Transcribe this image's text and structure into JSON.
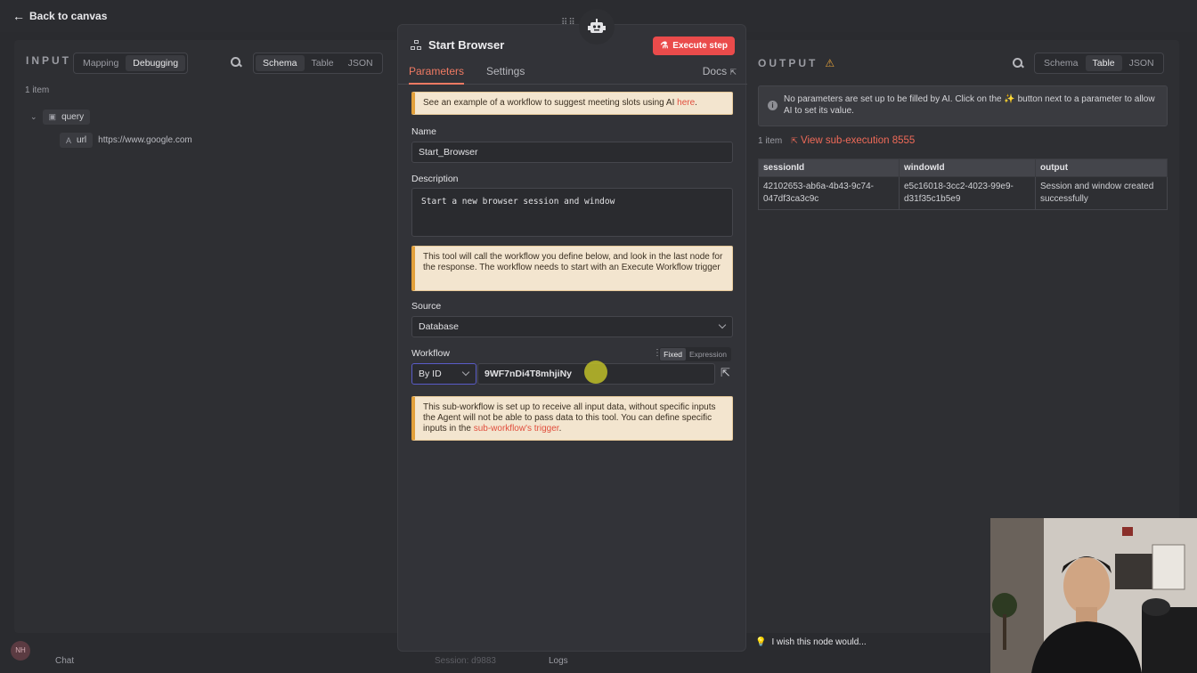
{
  "topbar": {
    "back_label": "Back to canvas"
  },
  "input_panel": {
    "title": "INPUT",
    "mode_tabs": [
      "Mapping",
      "Debugging"
    ],
    "view_tabs": [
      "Schema",
      "Table",
      "JSON"
    ],
    "item_count": "1 item",
    "tree": {
      "root_label": "query",
      "child_type": "A",
      "child_key": "url",
      "child_value": "https://www.google.com"
    }
  },
  "node": {
    "title": "Start Browser",
    "execute_label": "Execute step",
    "tabs": [
      "Parameters",
      "Settings"
    ],
    "docs_label": "Docs",
    "example_notice": "See an example of a workflow to suggest meeting slots using AI ",
    "example_link": "here",
    "name_label": "Name",
    "name_value": "Start_Browser",
    "description_label": "Description",
    "description_value": "Start a new browser session and window",
    "tool_notice": "This tool will call the workflow you define below, and look in the last node for the response. The workflow needs to start with an Execute Workflow trigger",
    "source_label": "Source",
    "source_value": "Database",
    "workflow_label": "Workflow",
    "mode_fixed": "Fixed",
    "mode_expression": "Expression",
    "by_label": "By ID",
    "workflow_id": "9WF7nDi4T8mhjiNy",
    "subworkflow_notice": "This sub-workflow is set up to receive all input data, without specific inputs the Agent will not be able to pass data to this tool. You can define specific inputs in the ",
    "subworkflow_link": "sub-workflow's trigger"
  },
  "output_panel": {
    "title": "OUTPUT",
    "view_tabs": [
      "Schema",
      "Table",
      "JSON"
    ],
    "ai_notice": "No parameters are set up to be filled by AI. Click on the ✨ button next to a parameter to allow AI to set its value.",
    "item_count": "1 item",
    "sub_execution": "View sub-execution 8555",
    "columns": [
      "sessionId",
      "windowId",
      "output"
    ],
    "rows": [
      [
        "42102653-ab6a-4b43-9c74-047df3ca3c9c",
        "e5c16018-3cc2-4023-99e9-d31f35c1b5e9",
        "Session and window created successfully"
      ]
    ]
  },
  "footer": {
    "wish": "I wish this node would...",
    "chat": "Chat",
    "session": "Session: d9883",
    "logs": "Logs",
    "avatar": "NH"
  }
}
